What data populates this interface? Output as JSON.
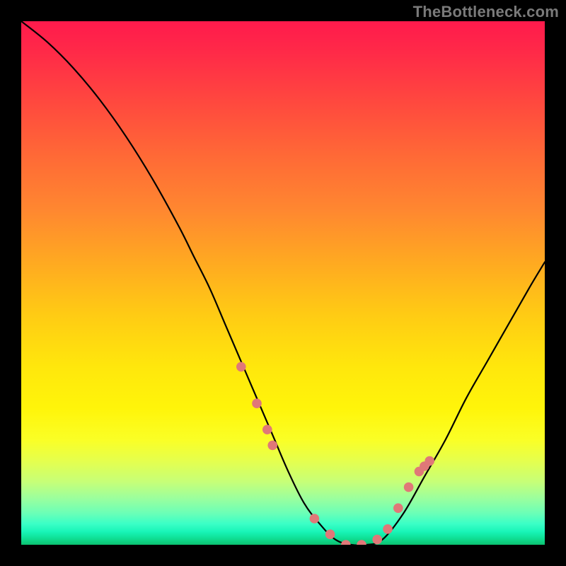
{
  "watermark": "TheBottleneck.com",
  "chart_data": {
    "type": "line",
    "title": "",
    "xlabel": "",
    "ylabel": "",
    "xlim": [
      0,
      100
    ],
    "ylim": [
      0,
      100
    ],
    "grid": false,
    "series": [
      {
        "name": "bottleneck-curve",
        "x": [
          0,
          5,
          10,
          15,
          20,
          25,
          30,
          33,
          36,
          39,
          42,
          45,
          48,
          51,
          54,
          57,
          60,
          63,
          66,
          69,
          73,
          77,
          81,
          85,
          89,
          93,
          97,
          100
        ],
        "values": [
          100,
          96,
          91,
          85,
          78,
          70,
          61,
          55,
          49,
          42,
          35,
          28,
          21,
          14,
          8,
          4,
          1,
          0,
          0,
          1,
          6,
          13,
          20,
          28,
          35,
          42,
          49,
          54
        ]
      }
    ],
    "markers": {
      "name": "highlight-dots",
      "color": "#e07878",
      "x": [
        42,
        45,
        47,
        48,
        56,
        59,
        62,
        65,
        68,
        70,
        72,
        74,
        76,
        77,
        78
      ],
      "values": [
        34,
        27,
        22,
        19,
        5,
        2,
        0,
        0,
        1,
        3,
        7,
        11,
        14,
        15,
        16
      ]
    },
    "gradient_stops": [
      {
        "pos": 0,
        "color": "#ff1a4c"
      },
      {
        "pos": 40,
        "color": "#ff8a30"
      },
      {
        "pos": 70,
        "color": "#ffe70c"
      },
      {
        "pos": 90,
        "color": "#b0ff80"
      },
      {
        "pos": 100,
        "color": "#0cc070"
      }
    ]
  }
}
